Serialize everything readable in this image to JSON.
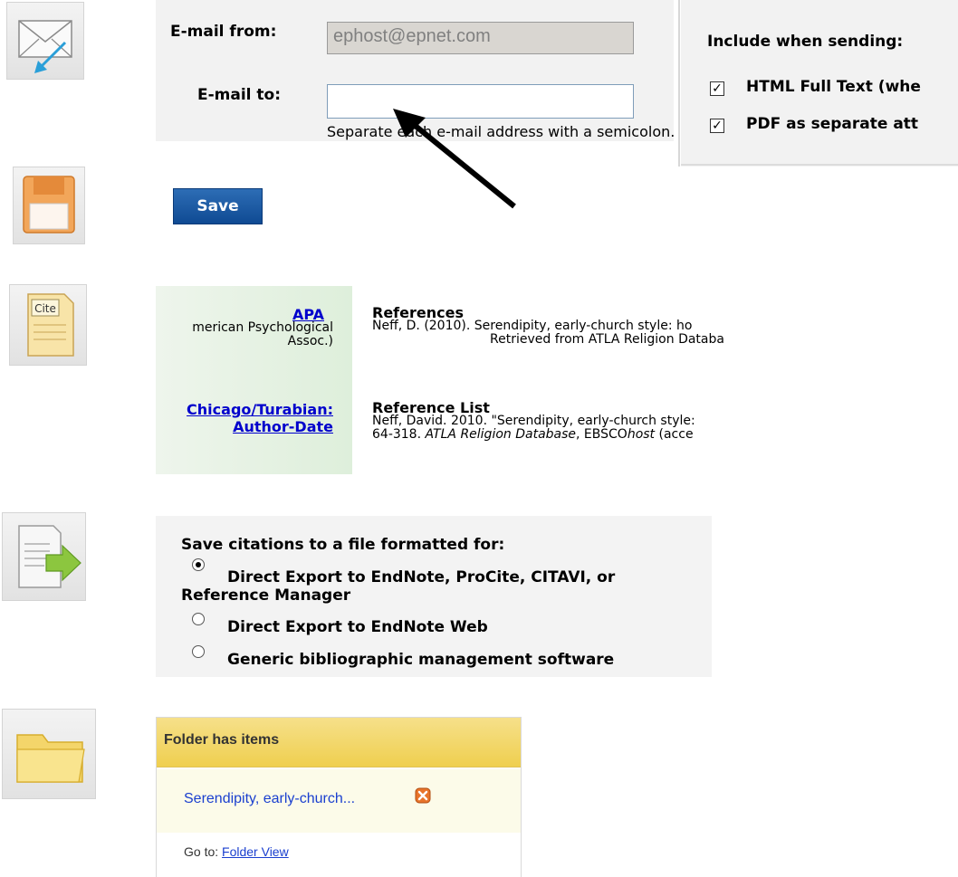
{
  "email": {
    "from_label": "E-mail from:",
    "from_value": "ephost@epnet.com",
    "to_label": "E-mail to:",
    "to_value": "",
    "hint": "Separate each e-mail address with a semicolon.",
    "include_title": "Include when sending:",
    "include_options": [
      {
        "label": "HTML Full Text (whe",
        "checked": true
      },
      {
        "label": "PDF as separate att",
        "checked": true
      }
    ]
  },
  "save": {
    "label": "Save"
  },
  "cite": {
    "styles": [
      {
        "name": "APA",
        "desc_line1": "merican Psychological",
        "desc_line2": "Assoc.)",
        "heading": "References",
        "line1": "Neff, D. (2010). Serendipity, early-church style: ho",
        "line2": "Retrieved from ATLA Religion Databa"
      },
      {
        "name_line1": "Chicago/Turabian:",
        "name_line2": "Author-Date",
        "heading": "Reference List",
        "line1": "Neff, David. 2010. \"Serendipity, early-church style:",
        "line2_pre": "64-318. ",
        "line2_db": "ATLA Religion Database",
        "line2_mid": ", EBSCO",
        "line2_host": "host",
        "line2_post": " (acce"
      }
    ]
  },
  "export": {
    "title": "Save citations to a file formatted for:",
    "options": [
      {
        "line1": "Direct Export to EndNote, ProCite, CITAVI, or",
        "line2": "Reference Manager",
        "selected": true
      },
      {
        "line1": "Direct Export to EndNote Web",
        "selected": false
      },
      {
        "line1": "Generic bibliographic management software",
        "selected": false
      }
    ]
  },
  "folder": {
    "header": "Folder has items",
    "item": "Serendipity, early-church...",
    "goto_label": "Go to:",
    "goto_link": "Folder View"
  },
  "colors": {
    "link": "#0000cc",
    "save_button": "#1a5aa6",
    "folder_header": "#f2d766"
  },
  "icons": [
    "email-icon",
    "save-disk-icon",
    "cite-icon",
    "export-icon",
    "folder-icon",
    "arrow-annotation",
    "remove-x-icon"
  ]
}
